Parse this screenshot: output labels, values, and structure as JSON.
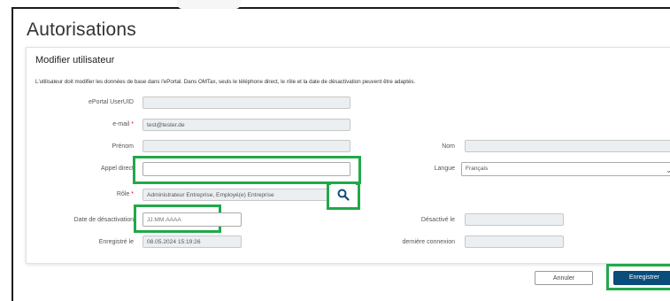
{
  "page": {
    "title": "Autorisations"
  },
  "form": {
    "section_title": "Modifier utilisateur",
    "info": "L'utilisateur doit modifier les données de base dans l'ePortal. Dans OMTax, seuls le téléphone direct, le rôle et la date de désactivation peuvent être adaptés.",
    "required_marker": "*",
    "fields": {
      "eportal_uid": {
        "label": "ePortal UserUID",
        "value": ""
      },
      "email": {
        "label": "e-mail",
        "value": "test@tester.de"
      },
      "prenom": {
        "label": "Prénom",
        "value": ""
      },
      "nom": {
        "label": "Nom",
        "value": ""
      },
      "appel_direct": {
        "label": "Appel direct",
        "value": ""
      },
      "langue": {
        "label": "Langue",
        "value": "Français"
      },
      "role": {
        "label": "Rôle",
        "value": "Administrateur Entreprise, Employé(e) Entreprise"
      },
      "date_desactivation": {
        "label": "Date de désactivation",
        "placeholder": "JJ.MM.AAAA"
      },
      "desactive_le": {
        "label": "Désactivé le",
        "value": ""
      },
      "enregistre_le": {
        "label": "Enregistré le",
        "value": "08.05.2024 15:19:26"
      },
      "derniere_connexion": {
        "label": "dernière connexion",
        "value": ""
      }
    }
  },
  "buttons": {
    "cancel": "Annuler",
    "save": "Enregistrer"
  },
  "colors": {
    "highlight": "#22a84a",
    "primary": "#0a4c7a",
    "required": "#d0021b"
  },
  "icons": {
    "search": "search-icon",
    "dropdown": "chevron-down-icon"
  }
}
